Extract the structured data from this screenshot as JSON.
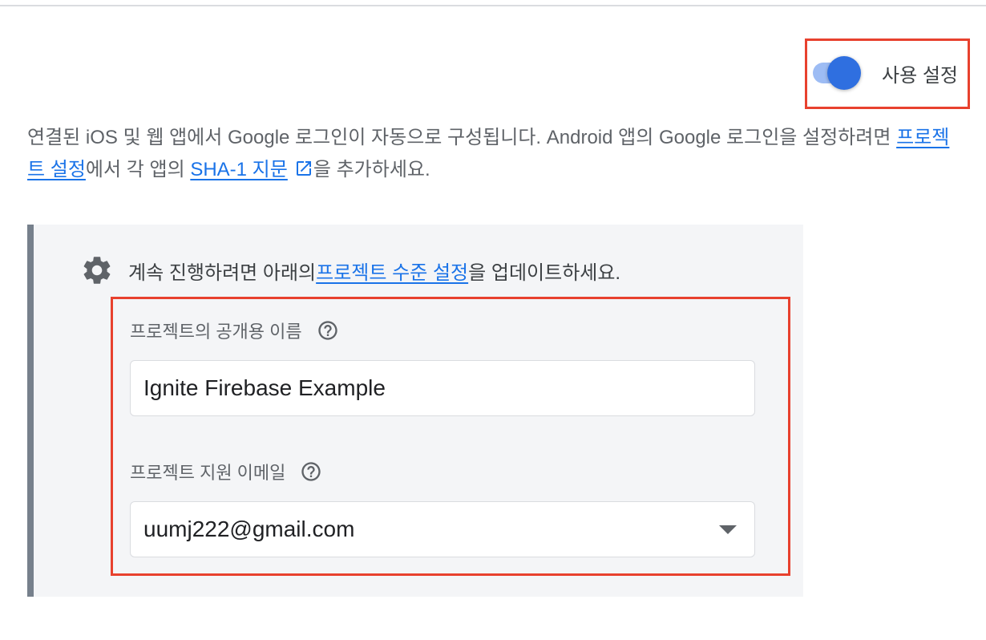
{
  "toggle": {
    "label": "사용 설정",
    "enabled": true,
    "accent_color": "#2f6fe0"
  },
  "description": {
    "text_1": "연결된 iOS 및 웹 앱에서 Google 로그인이 자동으로 구성됩니다. Android 앱의 Google 로그인을 설정하려면 ",
    "project_settings_link": "프로젝트 설정",
    "text_2": "에서 각 앱의 ",
    "sha1_link": "SHA-1 지문",
    "text_3": "을 추가하세요.",
    "external_icon": "external-link-icon"
  },
  "notice": {
    "icon": "gear-icon",
    "text_1": "계속 진행하려면 아래의 ",
    "link": "프로젝트 수준 설정",
    "text_2": "을 업데이트하세요."
  },
  "form": {
    "public_name": {
      "label": "프로젝트의 공개용 이름",
      "value": "Ignite Firebase Example",
      "help_icon": "help-icon"
    },
    "support_email": {
      "label": "프로젝트 지원 이메일",
      "value": "uumj222@gmail.com",
      "help_icon": "help-icon",
      "dropdown_icon": "caret-down-icon"
    }
  },
  "colors": {
    "highlight": "#e8412e",
    "link": "#1a73e8",
    "panel_bg": "#f4f5f7",
    "panel_border": "#76808c"
  }
}
